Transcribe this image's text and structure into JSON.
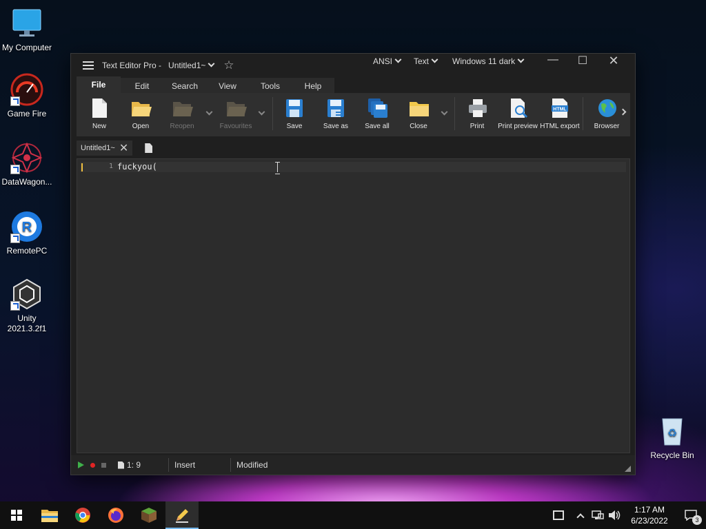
{
  "desktop": {
    "icons": [
      {
        "label": "My Computer"
      },
      {
        "label": "Game Fire"
      },
      {
        "label": "DataWagon..."
      },
      {
        "label": "RemotePC"
      },
      {
        "label": "Unity\n2021.3.2f1"
      },
      {
        "label": "Recycle Bin"
      }
    ]
  },
  "window": {
    "app_title": "Text Editor Pro  -",
    "doc_title": "Untitled1~",
    "encoding": "ANSI",
    "syntax": "Text",
    "theme": "Windows 11 dark",
    "minimize": "—",
    "maximize": "☐",
    "close": "✕"
  },
  "menu_tabs": [
    "File",
    "Edit",
    "Search",
    "View",
    "Tools",
    "Help"
  ],
  "ribbon": {
    "new": "New",
    "open": "Open",
    "reopen": "Reopen",
    "favourites": "Favourites",
    "save": "Save",
    "save_as": "Save as",
    "save_all": "Save all",
    "close": "Close",
    "print": "Print",
    "print_preview": "Print preview",
    "html_export": "HTML export",
    "browser": "Browser"
  },
  "doc_tabs": [
    {
      "label": "Untitled1~"
    }
  ],
  "editor": {
    "line_number": "1",
    "line_text": "fuckyou("
  },
  "status": {
    "position": "1: 9",
    "mode": "Insert",
    "modified": "Modified"
  },
  "taskbar": {
    "time": "1:17 AM",
    "date": "6/23/2022",
    "notifications": "3"
  },
  "colors": {
    "accent": "#76b9ed",
    "window_bg": "#1f1f1f",
    "ribbon_bg": "#2f2f2f",
    "editor_bg": "#2c2c2c"
  }
}
